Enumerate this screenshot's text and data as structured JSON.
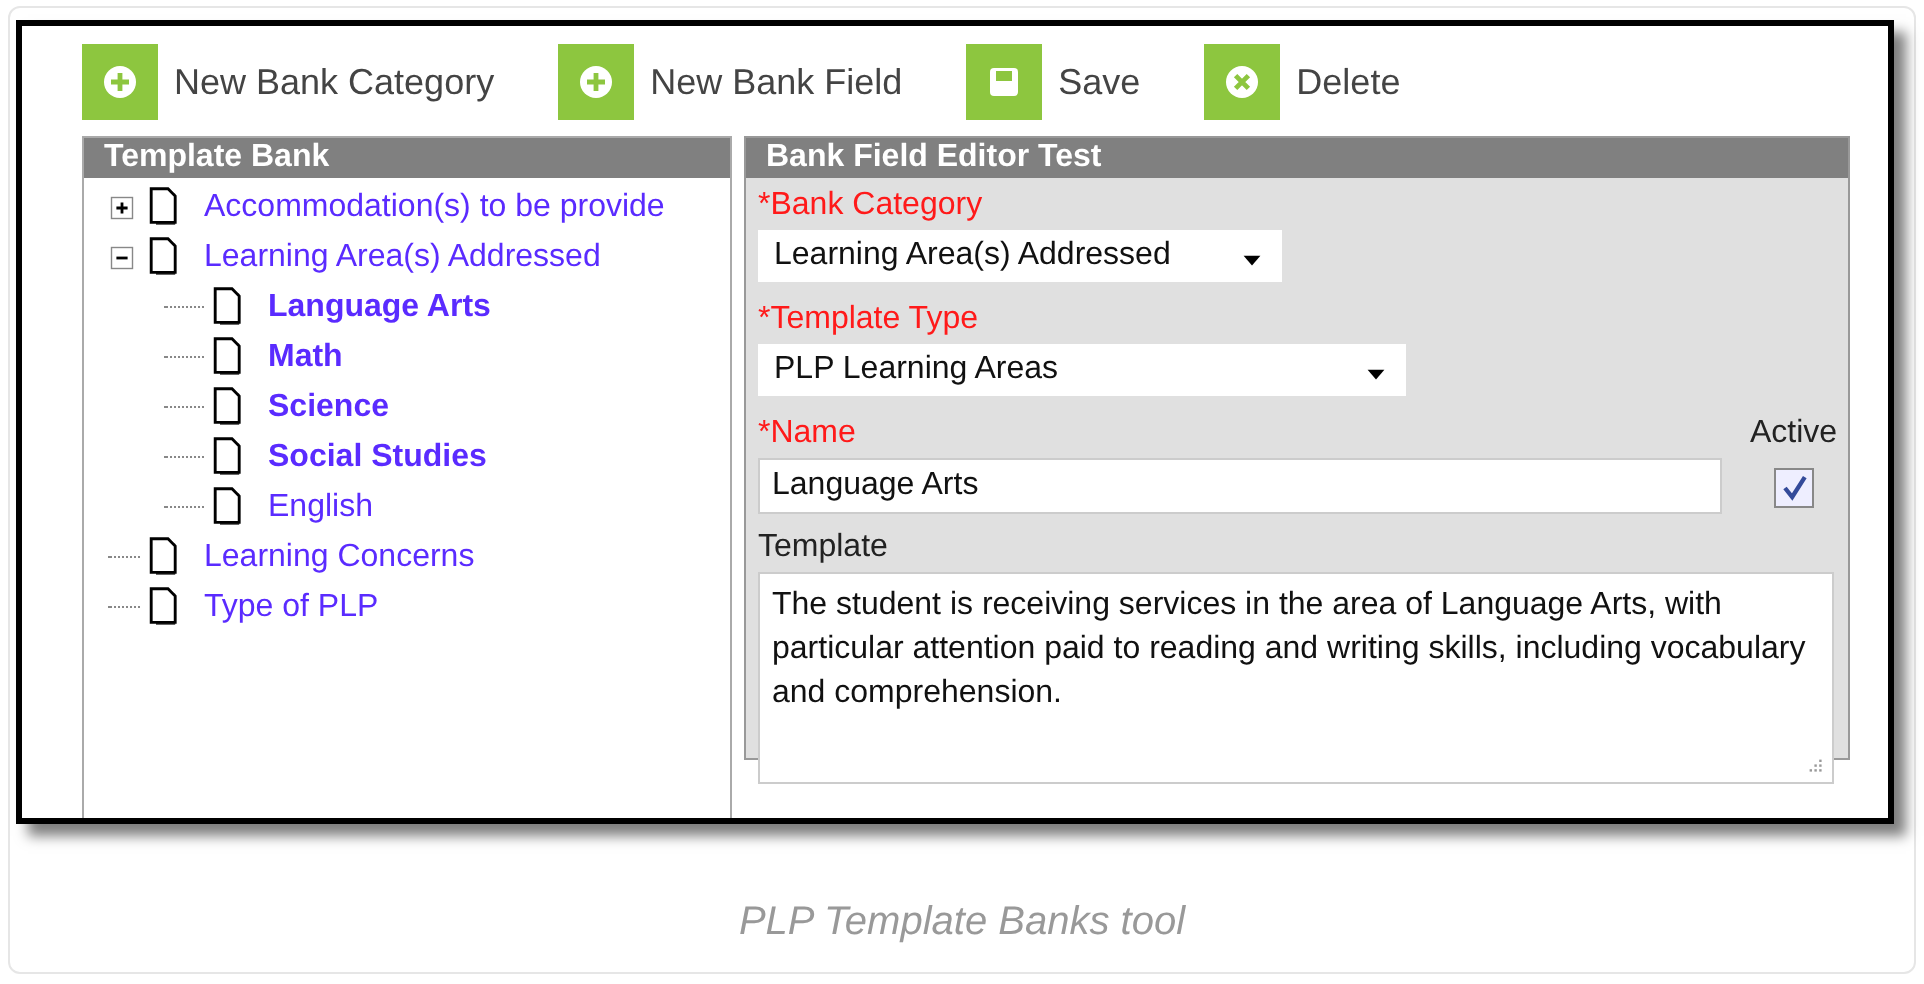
{
  "toolbar": [
    {
      "label": "New Bank Category",
      "kind": "add"
    },
    {
      "label": "New Bank Field",
      "kind": "add"
    },
    {
      "label": "Save",
      "kind": "save"
    },
    {
      "label": "Delete",
      "kind": "delete"
    }
  ],
  "template_bank": {
    "title": "Template Bank",
    "items": [
      {
        "label": "Accommodation(s) to be provide",
        "expanded": false,
        "bold": false
      },
      {
        "label": "Learning Area(s) Addressed",
        "expanded": true,
        "bold": false,
        "children": [
          {
            "label": "Language Arts",
            "bold": true
          },
          {
            "label": "Math",
            "bold": true
          },
          {
            "label": "Science",
            "bold": true
          },
          {
            "label": "Social Studies",
            "bold": true
          },
          {
            "label": "English",
            "bold": false
          }
        ]
      },
      {
        "label": "Learning Concerns",
        "bold": false
      },
      {
        "label": "Type of PLP",
        "bold": false
      }
    ]
  },
  "editor": {
    "title": "Bank Field Editor Test",
    "bank_category": {
      "label": "*Bank Category",
      "value": "Learning Area(s) Addressed"
    },
    "template_type": {
      "label": "*Template Type",
      "value": "PLP Learning Areas"
    },
    "name": {
      "label": "*Name",
      "value": "Language Arts"
    },
    "active": {
      "label": "Active",
      "checked": true
    },
    "template": {
      "label": "Template",
      "value": "The student is receiving services in the area of Language Arts, with particular attention paid to reading and writing skills, including vocabulary and comprehension."
    }
  },
  "caption": "PLP Template Banks tool"
}
